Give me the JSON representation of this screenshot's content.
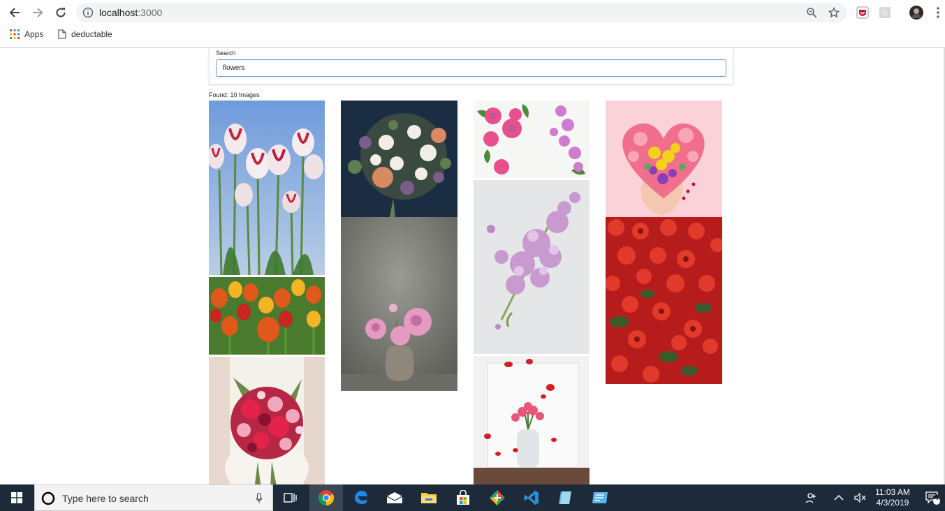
{
  "browser": {
    "url_host": "localhost",
    "url_port": ":3000",
    "bookmarks": [
      {
        "label": "Apps",
        "icon": "apps-grid-icon"
      },
      {
        "label": "deductable",
        "icon": "page-icon"
      }
    ]
  },
  "page": {
    "search": {
      "label": "Search",
      "value": "flowers"
    },
    "found_text": "Found: 10 Images",
    "images": [
      {
        "subject": "tulips-sky",
        "colors": [
          "#7fa8de",
          "#f2e7e9",
          "#c9243e",
          "#4f7a3a"
        ]
      },
      {
        "subject": "orange-tulips",
        "colors": [
          "#e05a1a",
          "#f5b423",
          "#3f7a2c",
          "#c8261f"
        ]
      },
      {
        "subject": "bridal-bouquet",
        "colors": [
          "#f3efe8",
          "#c3183a",
          "#e88aa6",
          "#6b8a4a"
        ]
      },
      {
        "subject": "dark-bouquet",
        "colors": [
          "#1e3148",
          "#f2efe8",
          "#7b5d8b",
          "#d88a62"
        ]
      },
      {
        "subject": "peonies-vase",
        "colors": [
          "#8c8c86",
          "#6e6e69",
          "#e7a3c6",
          "#8f857c"
        ]
      },
      {
        "subject": "pink-roses-flatlay",
        "colors": [
          "#f7f7f5",
          "#e94f8c",
          "#c272c4",
          "#4e8a3b"
        ]
      },
      {
        "subject": "lilac",
        "colors": [
          "#e4e5e7",
          "#c99ad0",
          "#e3c6e6",
          "#8aa85a"
        ]
      },
      {
        "subject": "roses-vase-petals",
        "colors": [
          "#f2f2f2",
          "#e9567a",
          "#cf1f24",
          "#6a4a3a"
        ]
      },
      {
        "subject": "floral-heart-hands",
        "colors": [
          "#fcd2d9",
          "#f06f8d",
          "#f4d21b",
          "#8a3fb8"
        ]
      },
      {
        "subject": "red-begonias",
        "colors": [
          "#c31d1d",
          "#e23a2a",
          "#3a5a2a",
          "#8a1010"
        ]
      }
    ]
  },
  "taskbar": {
    "search_placeholder": "Type here to search",
    "time": "11:03 AM",
    "date": "4/3/2019",
    "notification_count": "4",
    "apps": [
      "task-view-icon",
      "chrome-icon",
      "edge-icon",
      "mail-icon",
      "file-explorer-icon",
      "store-icon",
      "app-icon",
      "vscode-icon",
      "notes-icon",
      "app2-icon"
    ]
  }
}
